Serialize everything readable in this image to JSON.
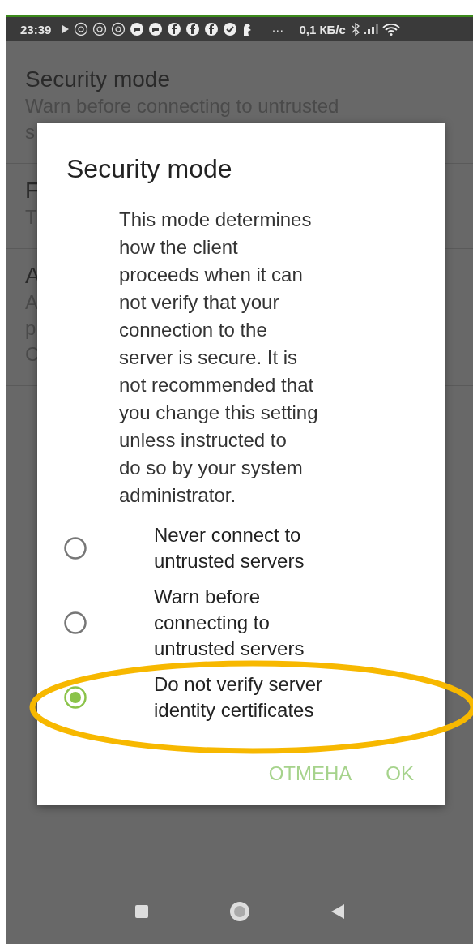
{
  "status_bar": {
    "time": "23:39",
    "more": "···",
    "speed": "0,1 КБ/с"
  },
  "settings": [
    {
      "title": "Security mode",
      "summary": [
        "Warn before connecting to untrusted",
        "s"
      ]
    },
    {
      "title": "F",
      "summary": [
        "T"
      ]
    },
    {
      "title": "A",
      "summary": [
        "A",
        "p",
        "C"
      ]
    }
  ],
  "dialog": {
    "title": "Security mode",
    "message": [
      "This mode determines",
      "how the client",
      "proceeds when it can",
      "not verify that your",
      "connection to the",
      "server is secure. It is",
      "not recommended that",
      "you change this setting",
      "unless instructed to",
      "do so by your system",
      "administrator."
    ],
    "options": [
      {
        "label": "Never connect to untrusted servers",
        "selected": false
      },
      {
        "label": "Warn before connecting to untrusted servers",
        "selected": false
      },
      {
        "label": "Do not verify server identity certificates",
        "selected": true
      }
    ],
    "buttons": [
      "ОТМЕНА",
      "OK"
    ]
  }
}
